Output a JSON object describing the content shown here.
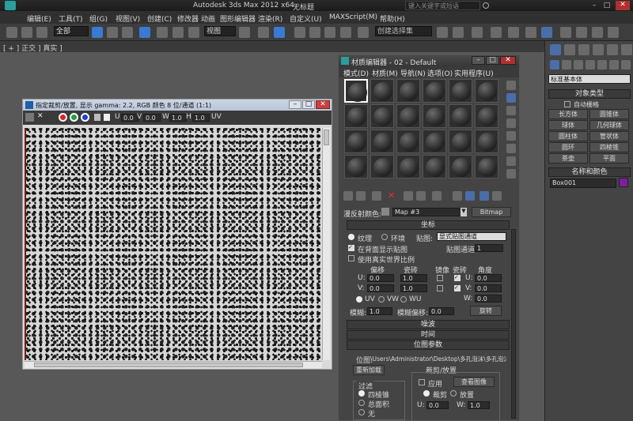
{
  "app": {
    "title": "Autodesk 3ds Max  2012 x64",
    "doc": "无标题",
    "search_placeholder": "键入关键字或短语"
  },
  "menu": [
    "编辑(E)",
    "工具(T)",
    "组(G)",
    "视图(V)",
    "创建(C)",
    "修改器",
    "动画",
    "图形编辑器",
    "渲染(R)",
    "自定义(U)",
    "MAXScript(M)",
    "帮助(H)"
  ],
  "toolbar": {
    "filter": "全部",
    "coord": "视图",
    "selset": "创建选择集"
  },
  "viewport_label": "[ + ] 正交 ] 真实 ]",
  "bitmap_window": {
    "title": "指定裁剪/放置, 显示 gamma: 2.2, RGB 颜色 8 位/通道 (1:1)",
    "u_label": "U",
    "u_val": "0.0",
    "v_label": "V",
    "v_val": "0.0",
    "w_label": "W",
    "w_val": "1.0",
    "h_label": "H",
    "h_val": "1.0",
    "uv": "UV"
  },
  "material_editor": {
    "title": "材质编辑器 - 02 - Default",
    "menu": [
      "模式(D)",
      "材质(M)",
      "导航(N)",
      "选项(O)",
      "实用程序(U)"
    ],
    "reflect_label": "漫反射颜色:",
    "map_name": "Map #3",
    "map_type": "Bitmap",
    "coords": {
      "rollout": "坐标",
      "texture": "纹理",
      "env": "环境",
      "mapping_label": "贴图:",
      "mapping": "显式贴图通道",
      "show_back": "在背面显示贴图",
      "channel_label": "贴图通道:",
      "channel": "1",
      "real_world": "使用真实世界比例",
      "offset": "偏移",
      "tiling": "瓷砖",
      "mirror": "镜像",
      "tile": "瓷砖",
      "angle": "角度",
      "u": "U:",
      "v": "V:",
      "w": "W:",
      "u_off": "0.0",
      "v_off": "0.0",
      "u_tile": "1.0",
      "v_tile": "1.0",
      "u_ang": "0.0",
      "v_ang": "0.0",
      "w_ang": "0.0",
      "uv": "UV",
      "vw": "VW",
      "wu": "WU",
      "blur_label": "模糊:",
      "blur": "1.0",
      "blur_off_label": "模糊偏移:",
      "blur_off": "0.0",
      "rotate": "旋转"
    },
    "noise": "噪波",
    "time": "时间",
    "bitmap_params": {
      "rollout": "位图参数",
      "path_label": "位图:",
      "path": "\\Users\\Administrator\\Desktop\\多孔泡沫\\多孔泡沫.jpg",
      "reload": "重新加载",
      "crop": "裁剪/放置",
      "apply": "应用",
      "view_image": "查看图像",
      "crop_opt": "裁剪",
      "place_opt": "放置",
      "filter": "过滤",
      "four_corner": "四棱锥",
      "summed": "总面积",
      "none": "无",
      "cu": "U:",
      "cu_val": "0.0",
      "cw": "W:",
      "cw_val": "1.0"
    }
  },
  "right_panel": {
    "dropdown": "标准基本体",
    "object_type": "对象类型",
    "autogrid": "自动栅格",
    "buttons": [
      "长方体",
      "圆锥体",
      "球体",
      "几何球体",
      "圆柱体",
      "管状体",
      "圆环",
      "四棱锥",
      "茶壶",
      "平面"
    ],
    "name_color": "名称和颜色",
    "name": "Box001",
    "color": "#7a1fa0"
  }
}
